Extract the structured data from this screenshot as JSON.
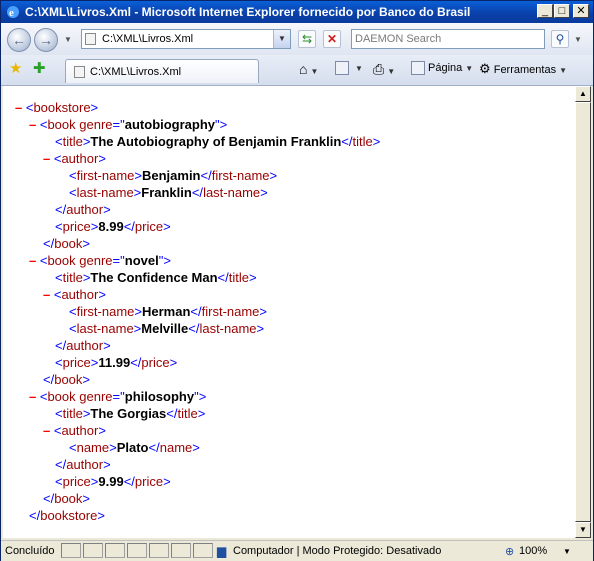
{
  "window": {
    "title": "C:\\XML\\Livros.Xml - Microsoft Internet Explorer fornecido por Banco do Brasil",
    "minimize": "_",
    "maximize": "□",
    "close": "✕"
  },
  "address": {
    "value": "C:\\XML\\Livros.Xml",
    "search_placeholder": "DAEMON Search"
  },
  "tab": {
    "label": "C:\\XML\\Livros.Xml"
  },
  "commands": {
    "page": "Página",
    "tools": "Ferramentas"
  },
  "xml": {
    "bookstore": "bookstore",
    "books": [
      {
        "genre": "autobiography",
        "title": "The Autobiography of Benjamin Franklin",
        "first_name": "Benjamin",
        "last_name": "Franklin",
        "price": "8.99"
      },
      {
        "genre": "novel",
        "title": "The Confidence Man",
        "first_name": "Herman",
        "last_name": "Melville",
        "price": "11.99"
      },
      {
        "genre": "philosophy",
        "title": "The Gorgias",
        "name": "Plato",
        "price": "9.99"
      }
    ]
  },
  "status": {
    "text": "Concluído",
    "zone": "Computador | Modo Protegido: Desativado",
    "zoom": "100%"
  }
}
